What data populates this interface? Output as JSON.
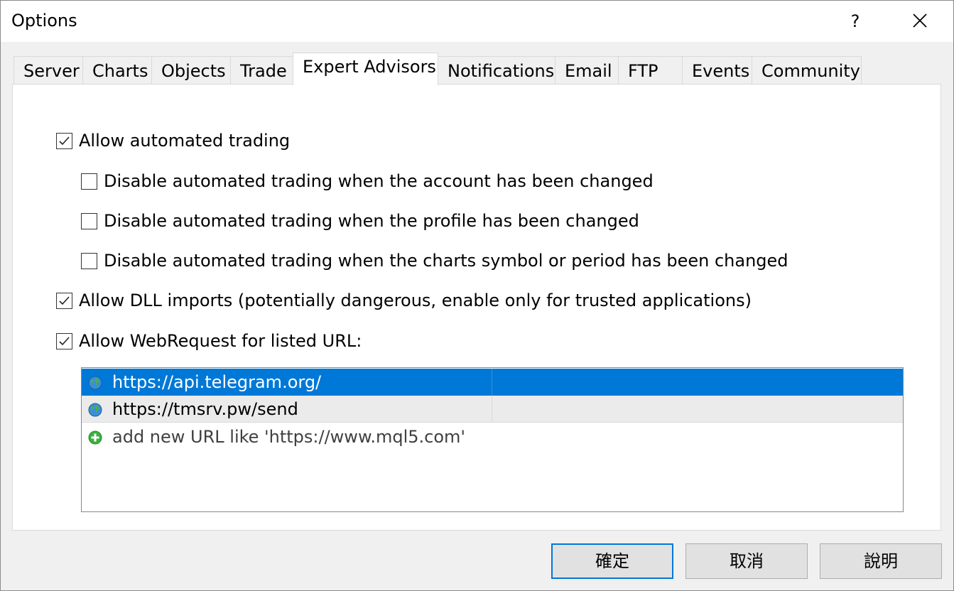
{
  "window": {
    "title": "Options",
    "help_label": "?"
  },
  "tabs": [
    {
      "label": "Server"
    },
    {
      "label": "Charts"
    },
    {
      "label": "Objects"
    },
    {
      "label": "Trade"
    },
    {
      "label": "Expert Advisors",
      "active": true
    },
    {
      "label": "Notifications"
    },
    {
      "label": "Email"
    },
    {
      "label": "FTP"
    },
    {
      "label": "Events"
    },
    {
      "label": "Community"
    }
  ],
  "options": {
    "allow_automated": {
      "label": "Allow automated trading",
      "checked": true
    },
    "disable_account": {
      "label": "Disable automated trading when the account has been changed",
      "checked": false
    },
    "disable_profile": {
      "label": "Disable automated trading when the profile has been changed",
      "checked": false
    },
    "disable_symbol": {
      "label": "Disable automated trading when the charts symbol or period has been changed",
      "checked": false
    },
    "allow_dll": {
      "label": "Allow DLL imports (potentially dangerous, enable only for trusted applications)",
      "checked": true
    },
    "allow_webrequest": {
      "label": "Allow WebRequest for listed URL:",
      "checked": true
    }
  },
  "url_list": {
    "items": [
      {
        "url": "https://api.telegram.org/",
        "selected": true,
        "icon": "globe-icon"
      },
      {
        "url": "https://tmsrv.pw/send",
        "selected": false,
        "icon": "globe-icon"
      }
    ],
    "add_placeholder": "add new URL like 'https://www.mql5.com'",
    "add_icon": "plus-circle-icon"
  },
  "buttons": {
    "ok": "確定",
    "cancel": "取消",
    "help": "說明"
  },
  "colors": {
    "selection": "#0078d7",
    "default_button_border": "#0078d7"
  }
}
